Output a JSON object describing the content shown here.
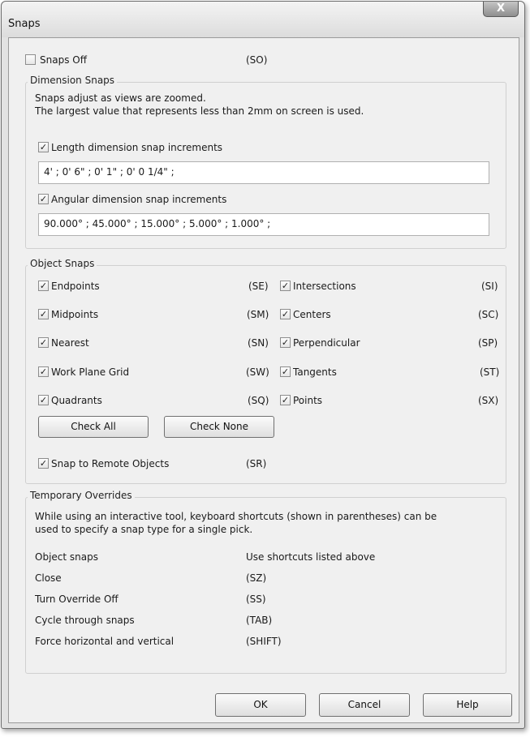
{
  "window": {
    "title": "Snaps",
    "close_label": "X"
  },
  "snaps_off": {
    "label": "Snaps Off",
    "shortcut": "(SO)",
    "checked": false
  },
  "dimension_snaps": {
    "title": "Dimension Snaps",
    "info_line1": "Snaps adjust as views are zoomed.",
    "info_line2": "The largest value that represents less than 2mm on screen is used.",
    "length": {
      "label": "Length dimension snap increments",
      "checked": true,
      "value": "4' ; 0'  6\" ; 0'  1\" ; 0'  0 1/4\" ;"
    },
    "angular": {
      "label": "Angular dimension snap increments",
      "checked": true,
      "value": "90.000° ; 45.000° ; 15.000° ; 5.000° ; 1.000° ;"
    }
  },
  "object_snaps": {
    "title": "Object Snaps",
    "left": [
      {
        "label": "Endpoints",
        "shortcut": "(SE)",
        "checked": true
      },
      {
        "label": "Midpoints",
        "shortcut": "(SM)",
        "checked": true
      },
      {
        "label": "Nearest",
        "shortcut": "(SN)",
        "checked": true
      },
      {
        "label": "Work Plane Grid",
        "shortcut": "(SW)",
        "checked": true
      },
      {
        "label": "Quadrants",
        "shortcut": "(SQ)",
        "checked": true
      }
    ],
    "right": [
      {
        "label": "Intersections",
        "shortcut": "(SI)",
        "checked": true
      },
      {
        "label": "Centers",
        "shortcut": "(SC)",
        "checked": true
      },
      {
        "label": "Perpendicular",
        "shortcut": "(SP)",
        "checked": true
      },
      {
        "label": "Tangents",
        "shortcut": "(ST)",
        "checked": true
      },
      {
        "label": "Points",
        "shortcut": "(SX)",
        "checked": true
      }
    ],
    "check_all_label": "Check All",
    "check_none_label": "Check None",
    "remote": {
      "label": "Snap to Remote Objects",
      "shortcut": "(SR)",
      "checked": true
    }
  },
  "temporary_overrides": {
    "title": "Temporary Overrides",
    "info_line1": "While using an interactive tool, keyboard shortcuts (shown in parentheses) can be",
    "info_line2": "used to specify a snap type for a single pick.",
    "rows": [
      {
        "label": "Object snaps",
        "value": "Use shortcuts listed above"
      },
      {
        "label": "Close",
        "value": "(SZ)"
      },
      {
        "label": "Turn Override Off",
        "value": "(SS)"
      },
      {
        "label": "Cycle through snaps",
        "value": "(TAB)"
      },
      {
        "label": "Force horizontal and vertical",
        "value": "(SHIFT)"
      }
    ]
  },
  "footer": {
    "ok_label": "OK",
    "cancel_label": "Cancel",
    "help_label": "Help"
  },
  "colors": {
    "dialog_bg": "#f0f0f0",
    "frame": "#e2e2e2",
    "close_button": "#9a9a9a"
  }
}
